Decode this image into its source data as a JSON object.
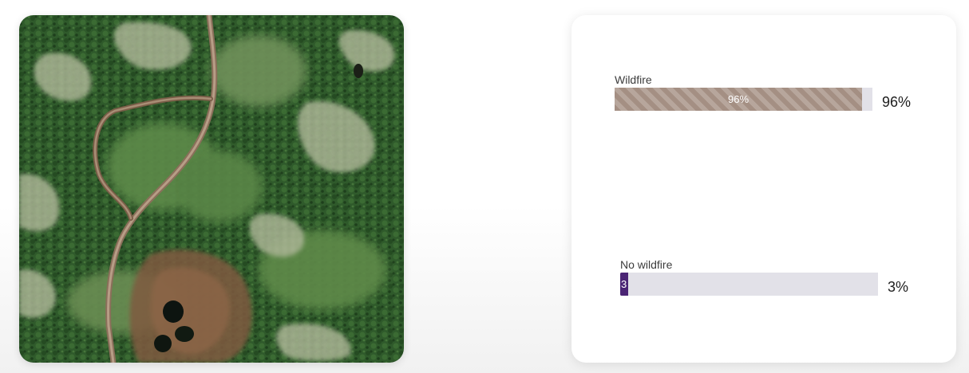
{
  "results": [
    {
      "label": "Wildfire",
      "value": 96,
      "bar_text": "96%",
      "percent_text": "96%",
      "fill_style": "hatched-brown"
    },
    {
      "label": "No wildfire",
      "value": 3,
      "bar_text": "3",
      "percent_text": "3%",
      "fill_style": "solid-purple"
    }
  ],
  "colors": {
    "wildfire_fill": "#a48f83",
    "no_wildfire_fill": "#4a2474",
    "track": "#e2e1e8",
    "card": "#ffffff"
  },
  "image": {
    "type": "satellite-forest-image"
  }
}
